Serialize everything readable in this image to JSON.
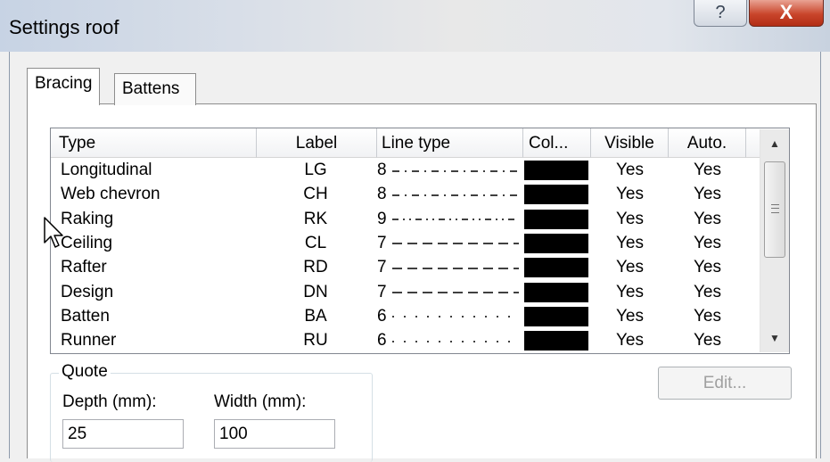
{
  "window": {
    "title": "Settings roof",
    "help_glyph": "?",
    "close_glyph": "X"
  },
  "tabs": [
    {
      "label": "Bracing",
      "active": true
    },
    {
      "label": "Battens",
      "active": false
    }
  ],
  "table": {
    "columns": [
      "Type",
      "Label",
      "Line type",
      "Col...",
      "Visible",
      "Auto."
    ],
    "rows": [
      {
        "type": "Longitudinal",
        "label": "LG",
        "line_num": "8",
        "line_style": "dash-dot",
        "color": "#000000",
        "visible": "Yes",
        "auto": "Yes"
      },
      {
        "type": "Web chevron",
        "label": "CH",
        "line_num": "8",
        "line_style": "dash-dot",
        "color": "#000000",
        "visible": "Yes",
        "auto": "Yes"
      },
      {
        "type": "Raking",
        "label": "RK",
        "line_num": "9",
        "line_style": "dash-dot-dot",
        "color": "#000000",
        "visible": "Yes",
        "auto": "Yes"
      },
      {
        "type": "Ceiling",
        "label": "CL",
        "line_num": "7",
        "line_style": "dashed",
        "color": "#000000",
        "visible": "Yes",
        "auto": "Yes"
      },
      {
        "type": "Rafter",
        "label": "RD",
        "line_num": "7",
        "line_style": "dashed",
        "color": "#000000",
        "visible": "Yes",
        "auto": "Yes"
      },
      {
        "type": "Design",
        "label": "DN",
        "line_num": "7",
        "line_style": "dashed",
        "color": "#000000",
        "visible": "Yes",
        "auto": "Yes"
      },
      {
        "type": "Batten",
        "label": "BA",
        "line_num": "6",
        "line_style": "dotted",
        "color": "#000000",
        "visible": "Yes",
        "auto": "Yes"
      },
      {
        "type": "Runner",
        "label": "RU",
        "line_num": "6",
        "line_style": "dotted",
        "color": "#000000",
        "visible": "Yes",
        "auto": "Yes"
      }
    ],
    "scroll_up_glyph": "▲",
    "scroll_down_glyph": "▼"
  },
  "quote": {
    "group_label": "Quote",
    "depth_label": "Depth (mm):",
    "depth_value": "25",
    "width_label": "Width (mm):",
    "width_value": "100"
  },
  "edit_button": {
    "label": "Edit...",
    "enabled": false
  },
  "colors": {
    "close_button": "#c9452b",
    "line_color": "#000000"
  },
  "icons": {
    "cursor": "arrow-cursor-icon",
    "scroll_up": "triangle-up-icon",
    "scroll_down": "triangle-down-icon"
  }
}
